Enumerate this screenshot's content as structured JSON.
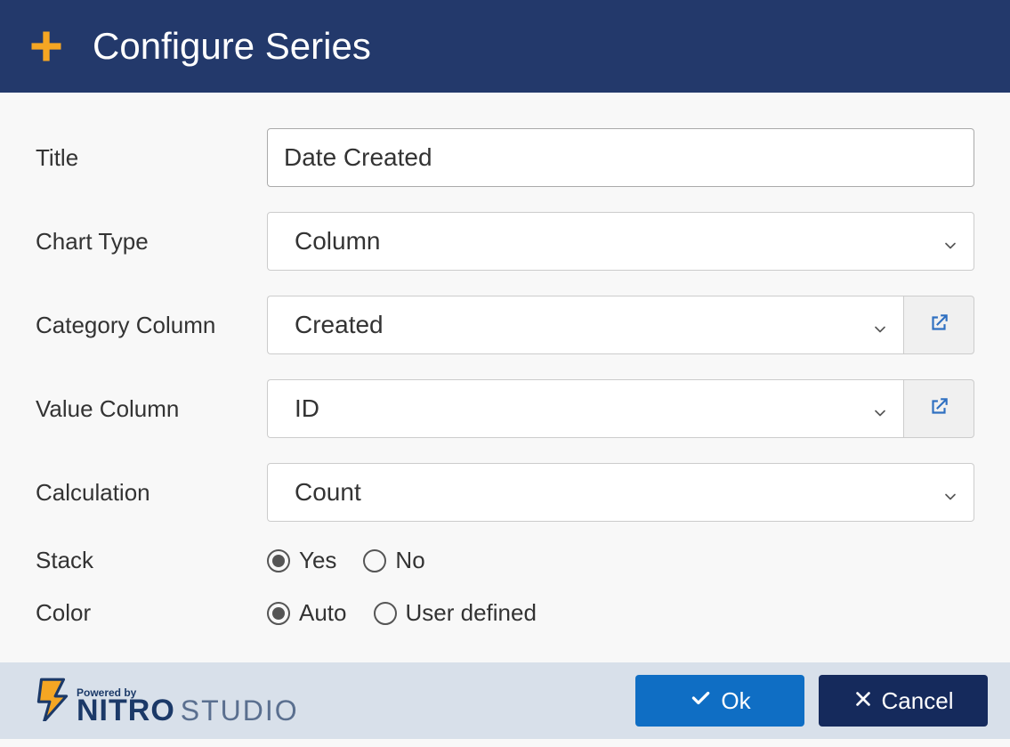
{
  "header": {
    "title": "Configure Series"
  },
  "form": {
    "title_label": "Title",
    "title_value": "Date Created",
    "chart_type_label": "Chart Type",
    "chart_type_value": "Column",
    "category_column_label": "Category Column",
    "category_column_value": "Created",
    "value_column_label": "Value Column",
    "value_column_value": "ID",
    "calculation_label": "Calculation",
    "calculation_value": "Count",
    "stack_label": "Stack",
    "stack_yes": "Yes",
    "stack_no": "No",
    "stack_selected": "Yes",
    "color_label": "Color",
    "color_auto": "Auto",
    "color_user": "User defined",
    "color_selected": "Auto"
  },
  "footer": {
    "powered_by": "Powered by",
    "brand1": "NITRO",
    "brand2": "STUDIO",
    "ok": "Ok",
    "cancel": "Cancel"
  }
}
